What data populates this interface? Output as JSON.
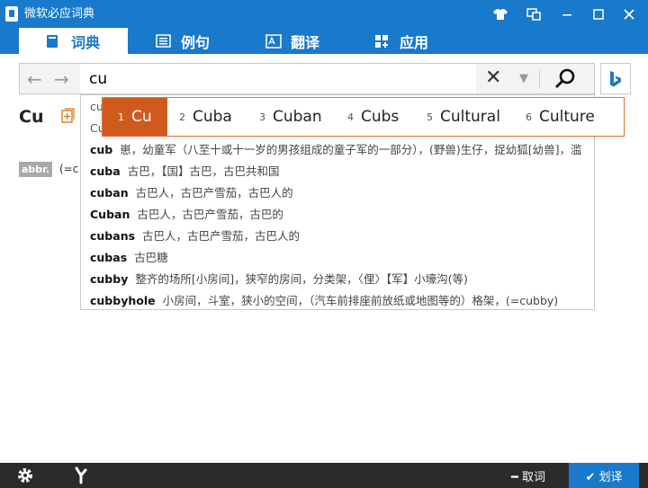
{
  "window": {
    "title": "微软必应词典"
  },
  "tabs": [
    {
      "label": "词典",
      "icon": "book-icon"
    },
    {
      "label": "例句",
      "icon": "list-icon"
    },
    {
      "label": "翻译",
      "icon": "translate-icon"
    },
    {
      "label": "应用",
      "icon": "apps-icon"
    }
  ],
  "search": {
    "value": "cu",
    "back_icon": "←",
    "forward_icon": "→",
    "clear_icon": "✕",
    "dropdown_icon": "▼"
  },
  "result_peek": {
    "word": "Cu",
    "abbr_tag": "abbr.",
    "abbr_def": "(=c"
  },
  "suggestions": [
    {
      "word": "cu",
      "meaning": ""
    },
    {
      "word": "Cu",
      "meaning": ""
    },
    {
      "word": "cub",
      "meaning": "崽，幼童军（八至十或十一岁的男孩组成的童子军的一部分），(野兽)生仔，捉幼狐[幼兽]，滥"
    },
    {
      "word": "cuba",
      "meaning": "古巴，【国】古巴，古巴共和国"
    },
    {
      "word": "cuban",
      "meaning": "古巴人，古巴产雪茄，古巴人的"
    },
    {
      "word": "Cuban",
      "meaning": "古巴人，古巴产雪茄，古巴的"
    },
    {
      "word": "cubans",
      "meaning": "古巴人，古巴产雪茄，古巴人的"
    },
    {
      "word": "cubas",
      "meaning": "古巴糖"
    },
    {
      "word": "cubby",
      "meaning": "整齐的场所[小房间]，狭窄的房间，分类架，〈俚〉【军】小壕沟(等)"
    },
    {
      "word": "cubbyhole",
      "meaning": "小房间，斗室，狭小的空间，（汽车前排座前放纸或地图等的）格架，(=cubby)"
    }
  ],
  "ime_candidates": [
    {
      "num": "1",
      "text": "Cu"
    },
    {
      "num": "2",
      "text": "Cuba"
    },
    {
      "num": "3",
      "text": "Cuban"
    },
    {
      "num": "4",
      "text": "Cubs"
    },
    {
      "num": "5",
      "text": "Cultural"
    },
    {
      "num": "6",
      "text": "Culture"
    }
  ],
  "bottom": {
    "cancel_label": "━ 取词",
    "translate_label": "✔ 划译"
  },
  "colors": {
    "brand_blue": "#1979ca",
    "ime_selected": "#cf5a1c",
    "bottom_bar": "#2b2b2b"
  }
}
